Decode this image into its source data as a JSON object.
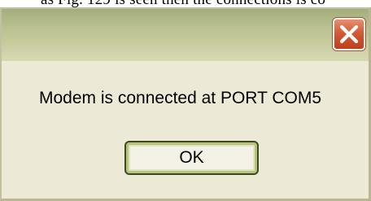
{
  "background_caption": "as Fig. 129 is seen then the connections is co",
  "dialog": {
    "title_controls": {
      "close_icon": "close-icon"
    },
    "message": "Modem is connected at PORT COM5",
    "ok_label": "OK"
  },
  "colors": {
    "titlebar": "#b9c08f",
    "body": "#ecead6",
    "close_button": "#d25a35",
    "ok_border": "#3b4a1e"
  }
}
